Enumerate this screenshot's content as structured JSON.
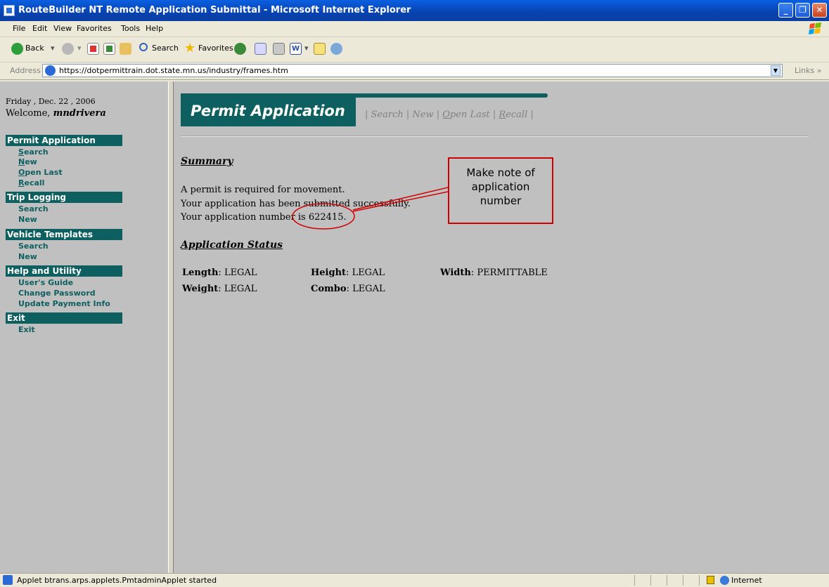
{
  "window": {
    "title": "RouteBuilder NT Remote Application Submittal - Microsoft Internet Explorer",
    "minimize": "_",
    "restore": "❐",
    "close": "✕"
  },
  "menu": [
    "File",
    "Edit",
    "View",
    "Favorites",
    "Tools",
    "Help"
  ],
  "toolbar": {
    "back": "Back",
    "search": "Search",
    "favorites": "Favorites"
  },
  "address": {
    "label": "Address",
    "url": "https://dotpermittrain.dot.state.mn.us/industry/frames.htm",
    "links": "Links"
  },
  "sidebar": {
    "date": "Friday , Dec. 22 , 2006",
    "welcome_prefix": "Welcome,",
    "username": "mndrivera",
    "sections": [
      {
        "title": "Permit Application",
        "items": [
          "Search",
          "New",
          "Open Last",
          "Recall"
        ]
      },
      {
        "title": "Trip Logging",
        "items": [
          "Search",
          "New"
        ]
      },
      {
        "title": "Vehicle Templates",
        "items": [
          "Search",
          "New"
        ]
      },
      {
        "title": "Help and Utility",
        "items": [
          "User's Guide",
          "Change Password",
          "Update Payment Info"
        ]
      },
      {
        "title": "Exit",
        "items": [
          "Exit"
        ]
      }
    ]
  },
  "main": {
    "banner": "Permit Application",
    "topnav": [
      "Search",
      "New",
      "Open Last",
      "Recall"
    ],
    "summary_heading": "Summary",
    "summary_lines": [
      "A permit is required for movement.",
      "Your application has been submitted successfully.",
      "Your application number is 622415."
    ],
    "status_heading": "Application Status",
    "status": {
      "length_label": "Length",
      "length_value": "LEGAL",
      "height_label": "Height",
      "height_value": "LEGAL",
      "width_label": "Width",
      "width_value": "PERMITTABLE",
      "weight_label": "Weight",
      "weight_value": "LEGAL",
      "combo_label": "Combo",
      "combo_value": "LEGAL"
    },
    "callout": [
      "Make note of",
      "application",
      "number"
    ]
  },
  "statusbar": {
    "text": "Applet btrans.arps.applets.PmtadminApplet started",
    "zone": "Internet"
  },
  "colors": {
    "nav_teal": "#0E5F5F",
    "frame_gray": "#C0C0C0",
    "annotation_red": "#D00000"
  }
}
